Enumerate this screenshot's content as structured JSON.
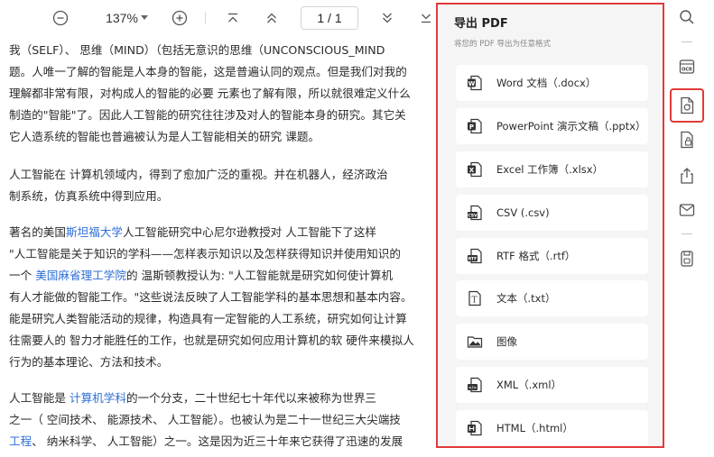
{
  "toolbar": {
    "zoom_out_icon": "minus-circle-icon",
    "zoom_value": "137%",
    "zoom_dropdown_icon": "caret-down-icon",
    "zoom_in_icon": "plus-circle-icon",
    "first_page_icon": "to-top-icon",
    "prev_page_icon": "double-chevron-up-icon",
    "page_indicator": "1 / 1",
    "next_page_icon": "double-chevron-down-icon",
    "last_page_icon": "to-bottom-icon"
  },
  "document": {
    "lines": [
      [
        "我（SELF）、 思维（MIND）（包括无意识的思维（UNCONSCIOUS_MIND"
      ],
      [
        "题。人唯一了解的智能是人本身的智能，这是普遍认同的观点。但是我们对我的"
      ],
      [
        "理解都非常有限，对构成人的智能的必要 元素也了解有限，所以就很难定义什么"
      ],
      [
        "制造的\"智能\"了。因此人工智能的研究往往涉及对人的智能本身的研究。其它关"
      ],
      [
        "它人造系统的智能也普遍被认为是人工智能相关的研究 课题。"
      ],
      [
        "    人工智能在 计算机领域内，得到了愈加广泛的重视。并在机器人，经济政治"
      ],
      [
        "制系统，仿真系统中得到应用。"
      ],
      [
        "    著名的美国",
        {
          "link": "斯坦福大学"
        },
        "人工智能研究中心尼尔逊教授对 人工智能下了这样"
      ],
      [
        "\"人工智能是关于知识的学科——怎样表示知识以及怎样获得知识并使用知识的"
      ],
      [
        "一个 ",
        {
          "link": "美国麻省理工学院"
        },
        "的 温斯顿教授认为: \"人工智能就是研究如何使计算机"
      ],
      [
        "有人才能做的智能工作。\"这些说法反映了人工智能学科的基本思想和基本内容。"
      ],
      [
        "能是研究人类智能活动的规律，构造具有一定智能的人工系统，研究如何让计算"
      ],
      [
        "往需要人的 智力才能胜任的工作，也就是研究如何应用计算机的软 硬件来模拟人"
      ],
      [
        "行为的基本理论、方法和技术。"
      ],
      [
        "    人工智能是 ",
        {
          "link": "计算机学科"
        },
        "的一个分支，二十世纪七十年代以来被称为世界三"
      ],
      [
        "之一（ 空间技术、 能源技术、 人工智能）。也被认为是二十一世纪三大尖端技"
      ],
      [
        {
          "link": "工程"
        },
        "、 纳米科学、 人工智能）之一。这是因为近三十年来它获得了迅速的发展"
      ]
    ]
  },
  "export_panel": {
    "title": "导出 PDF",
    "subtitle": "将您的 PDF 导出为任意格式",
    "options": [
      {
        "label": "Word 文档（.docx）",
        "icon": "word-doc-icon",
        "color": "#2b2b2b"
      },
      {
        "label": "PowerPoint 演示文稿（.pptx）",
        "icon": "powerpoint-icon",
        "color": "#2b2b2b"
      },
      {
        "label": "Excel 工作簿（.xlsx）",
        "icon": "excel-icon",
        "color": "#2b2b2b"
      },
      {
        "label": "CSV (.csv)",
        "icon": "csv-file-icon",
        "color": "#2b2b2b"
      },
      {
        "label": "RTF 格式（.rtf）",
        "icon": "rtf-file-icon",
        "color": "#2b2b2b"
      },
      {
        "label": "文本（.txt）",
        "icon": "text-file-icon",
        "color": "#2b2b2b"
      },
      {
        "label": "图像",
        "icon": "image-folder-icon",
        "color": "#2b2b2b"
      },
      {
        "label": "XML（.xml）",
        "icon": "xml-file-icon",
        "color": "#2b2b2b"
      },
      {
        "label": "HTML（.html）",
        "icon": "html-file-icon",
        "color": "#2b2b2b"
      }
    ]
  },
  "right_rail": {
    "items": [
      {
        "icon": "search-icon"
      },
      {
        "icon": "ocr-icon"
      },
      {
        "icon": "export-pdf-icon",
        "active": true
      },
      {
        "icon": "protect-file-icon"
      },
      {
        "icon": "share-icon"
      },
      {
        "icon": "mail-icon"
      },
      {
        "icon": "save-icon"
      }
    ]
  },
  "colors": {
    "highlight_border": "#e23a3a",
    "link": "#2f6fd6",
    "panel_bg": "#f5f5f6"
  }
}
